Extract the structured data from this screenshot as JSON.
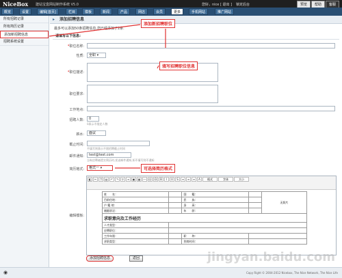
{
  "topbar": {
    "logo": "NiceBox",
    "subtitle": "建站宝盒网站制作系统 V5.0",
    "user": "您好，nice [ 退出 ]",
    "lock_label": "锁定后台",
    "btn_preview": "预览",
    "btn_help": "帮助",
    "btn_service": "客服"
  },
  "nav": {
    "items": [
      "概览",
      "设置",
      "编辑[首页]",
      "栏目",
      "模板",
      "新闻",
      "产品",
      "网店",
      "会员",
      "更多",
      "手机网站",
      "推广网站"
    ],
    "active_index": 9
  },
  "sidebar": {
    "items": [
      "所有招聘记录",
      "所有简历记录",
      "添加新招聘信息",
      "招聘系统设置"
    ],
    "selected_index": 2
  },
  "main": {
    "header": "添加招聘信息",
    "notice": "最多可以添加50条招聘信息,您已经添加了2条.",
    "fill_title": "请填写以下信息:",
    "labels": {
      "title": "职位名称:",
      "nature": "性质:",
      "desc": "职位描述:",
      "req": "职位要求:",
      "place": "工作地点:",
      "count": "招聘人数:",
      "salary": "薪水:",
      "deadline": "截止时间:",
      "email": "邮件通知:",
      "resume_format": "简历格式:",
      "template": "编辑模板:"
    },
    "values": {
      "nature": "全职",
      "count": "0",
      "salary": "面议",
      "email": "test@test.com",
      "resume_format": "格式一"
    },
    "hints": {
      "count": "0表示不限定人数",
      "deadline": "不填写则表示不限招聘截止时间",
      "email": "当有应聘者提交简历时,发送邮件通知,如不填写则不通知"
    },
    "required_mark": "*"
  },
  "callouts": {
    "add": "添加新招聘职位",
    "fill": "填写招聘职位信息",
    "format": "可选择简历格式"
  },
  "editor": {
    "toolbar_format": "格式",
    "toolbar_font": "字体",
    "toolbar_size": "大小",
    "resume": {
      "name": "姓　　名：",
      "nation": "国　　籍：",
      "job": "目前住地：",
      "ethnic": "民　　族：",
      "huji": "户 籍 地：",
      "height": "身　　高：",
      "marry": "婚姻状况：",
      "age": "年　　龄：",
      "photo": "无照片",
      "section": "求职意向及工作经历",
      "type": "人才类型：",
      "apply": "应聘职位：",
      "years": "工作年限：",
      "title": "职　　称：",
      "wanted": "求职类型：",
      "arrive": "到岗时间："
    }
  },
  "buttons": {
    "submit": "添加招聘信息",
    "back": "返回"
  },
  "footer": {
    "copyright": "Copy Right © 2004-2012 Nicebox, The Nice Network, The Nice Life"
  },
  "watermark": "jingyan.baidu.com"
}
